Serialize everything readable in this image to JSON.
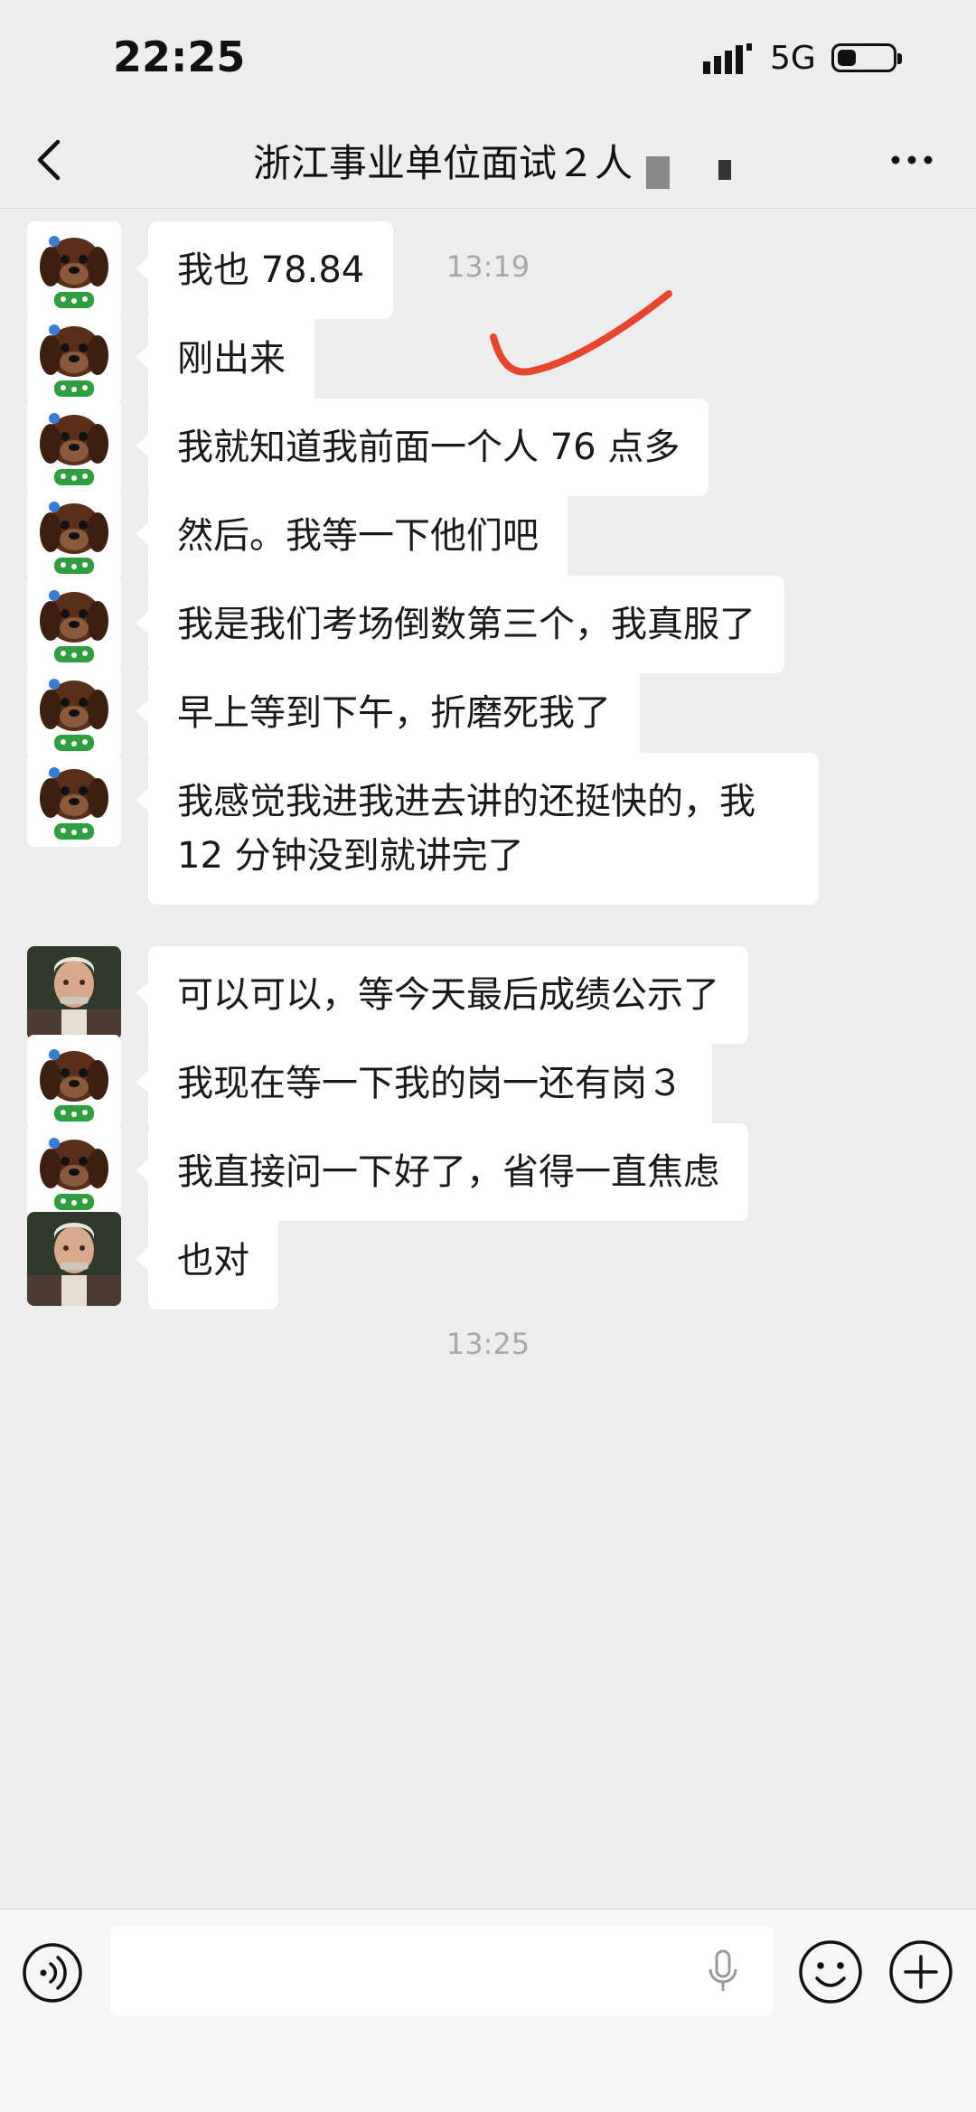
{
  "status": {
    "time": "22:25",
    "network": "5G",
    "battery_level": 0.35
  },
  "header": {
    "title": "浙江事业单位面试２人"
  },
  "timestamps": [
    "13:19",
    "13:25"
  ],
  "messages": [
    {
      "sender": "puppy",
      "text": "我也 78.84"
    },
    {
      "sender": "puppy",
      "text": "刚出来"
    },
    {
      "sender": "puppy",
      "text": "我就知道我前面一个人 76 点多"
    },
    {
      "sender": "puppy",
      "text": "然后。我等一下他们吧"
    },
    {
      "sender": "puppy",
      "text": "我是我们考场倒数第三个，我真服了"
    },
    {
      "sender": "puppy",
      "text": "早上等到下午，折磨死我了"
    },
    {
      "sender": "puppy",
      "text": "我感觉我进我进去讲的还挺快的，我 12 分钟没到就讲完了"
    },
    {
      "sender": "elder",
      "text": "可以可以，等今天最后成绩公示了"
    },
    {
      "sender": "puppy",
      "text": "我现在等一下我的岗一还有岗３"
    },
    {
      "sender": "puppy",
      "text": "我直接问一下好了，省得一直焦虑"
    },
    {
      "sender": "elder",
      "text": "也对"
    }
  ],
  "icons": {
    "back": "chevron-left-icon",
    "more": "more-dots-icon",
    "voice": "voice-icon",
    "mic": "microphone-icon",
    "emoji": "emoji-icon",
    "plus": "plus-icon"
  },
  "colors": {
    "background": "#ededed",
    "bubble": "#ffffff",
    "annotation": "#e8452f"
  }
}
